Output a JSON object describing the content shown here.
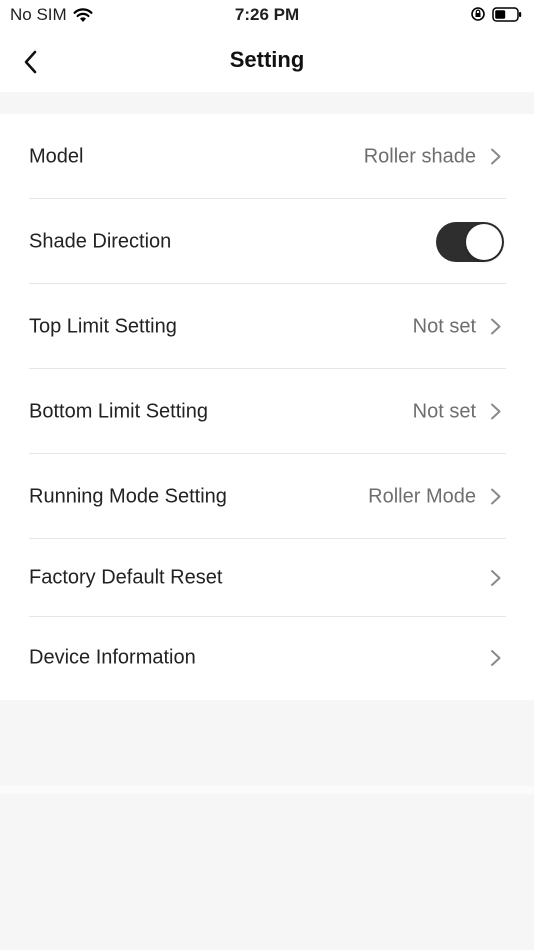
{
  "status_bar": {
    "carrier": "No SIM",
    "time": "7:26 PM",
    "icons": [
      "wifi-icon",
      "orientation-lock-icon",
      "battery-icon"
    ]
  },
  "header": {
    "title": "Setting",
    "back_icon": "chevron-left-icon"
  },
  "settings": {
    "model": {
      "label": "Model",
      "value": "Roller shade"
    },
    "shade_direction": {
      "label": "Shade Direction",
      "toggle_on": true
    },
    "top_limit": {
      "label": "Top Limit Setting",
      "value": "Not set"
    },
    "bottom_limit": {
      "label": "Bottom Limit Setting",
      "value": "Not set"
    },
    "running_mode": {
      "label": "Running Mode Setting",
      "value": "Roller Mode"
    },
    "factory_reset": {
      "label": "Factory Default Reset"
    },
    "device_info": {
      "label": "Device Information"
    }
  },
  "colors": {
    "toggle_on": "#2e2e2e",
    "background_gray": "#f6f6f6",
    "divider": "#e6e6e6",
    "value_text": "#6e6e6e"
  }
}
